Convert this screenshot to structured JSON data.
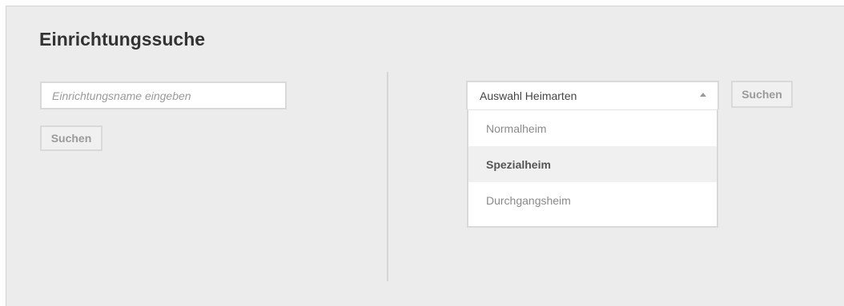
{
  "header": {
    "title": "Einrichtungssuche"
  },
  "name_search": {
    "placeholder": "Einrichtungsname eingeben",
    "value": "",
    "button_label": "Suchen"
  },
  "type_search": {
    "select_label": "Auswahl Heimarten",
    "options": [
      {
        "label": "Normalheim",
        "highlighted": false
      },
      {
        "label": "Spezialheim",
        "highlighted": true
      },
      {
        "label": "Durchgangsheim",
        "highlighted": false
      }
    ],
    "button_label": "Suchen"
  },
  "colors": {
    "panel_background": "#ececec",
    "border": "#d9d9d9",
    "title_text": "#333333",
    "muted_text": "#9a9a9a"
  },
  "icons": {
    "select_caret": "caret-up-icon"
  }
}
